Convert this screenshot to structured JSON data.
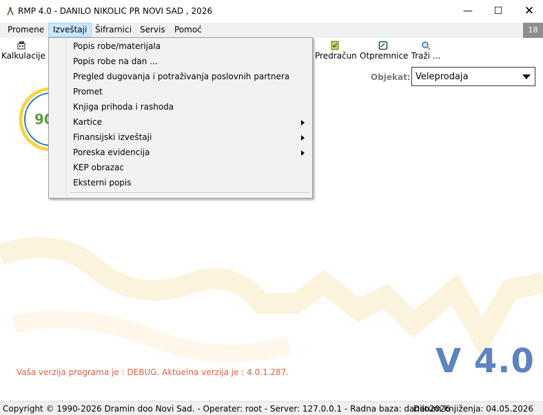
{
  "window": {
    "title": "RMP 4.0 - DANILO NIKOLIC PR NOVI SAD , 2026",
    "minimize": "—",
    "maximize": "☐",
    "close": "✕"
  },
  "menubar": {
    "items": [
      {
        "label": "Promene"
      },
      {
        "label": "Izveštaji"
      },
      {
        "label": "Šifrarnici"
      },
      {
        "label": "Servis"
      },
      {
        "label": "Pomoć"
      }
    ],
    "badge": "18"
  },
  "toolbar": {
    "items": [
      {
        "label": "Kalkulacije",
        "icon": "calculation-icon"
      },
      {
        "label": "Predračun",
        "icon": "invoice-icon"
      },
      {
        "label": "Otpremnice",
        "icon": "delivery-note-icon"
      },
      {
        "label": "Traži ...",
        "icon": "search-icon"
      }
    ]
  },
  "objekat": {
    "label": "Objekat:",
    "value": "Veleprodaja"
  },
  "dropdown": {
    "items": [
      {
        "label": "Popis robe/materijala",
        "submenu": false
      },
      {
        "label": "Popis robe na dan ...",
        "submenu": false
      },
      {
        "label": "Pregled dugovanja i potraživanja poslovnih partnera",
        "submenu": false
      },
      {
        "label": "Promet",
        "submenu": false
      },
      {
        "label": "Knjiga prihoda i rashoda",
        "submenu": false
      },
      {
        "label": "Kartice",
        "submenu": true
      },
      {
        "label": "Finansijski izveštaji",
        "submenu": true
      },
      {
        "label": "Poreska evidencija",
        "submenu": true
      },
      {
        "label": "KEP obrazac",
        "submenu": false
      },
      {
        "label": "Eksterni popis",
        "submenu": false
      }
    ]
  },
  "content": {
    "version_message": "Vaša verzija programa je : DEBUG. Aktuelna verzija je : 4.0.1.287.",
    "version_big": "V 4.0",
    "logo_text": "90"
  },
  "status": {
    "left": "Copyright © 1990-2026 Dramin doo Novi Sad. - Operater: root - Server: 127.0.0.1 - Radna baza: danilo2026",
    "right": "Datum knjiženja: 04.05.2026"
  },
  "colors": {
    "accent_version": "#5c84bf",
    "warning_text": "#e06040",
    "menu_highlight": "#cce8ff",
    "badge_bg": "#8e8e8e"
  }
}
